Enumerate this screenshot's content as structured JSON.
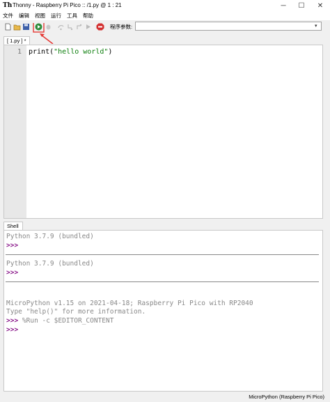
{
  "window": {
    "logo": "Th",
    "title": "Thonny  -  Raspberry Pi Pico :: /1.py  @  1 : 21",
    "minimize": "─",
    "maximize": "☐",
    "close": "✕"
  },
  "menu": [
    "文件",
    "编辑",
    "视图",
    "运行",
    "工具",
    "帮助"
  ],
  "toolbar": {
    "buttons": [
      "new-file-icon",
      "open-file-icon",
      "save-icon",
      "run-icon",
      "debug-icon",
      "step-over-icon",
      "step-into-icon",
      "step-out-icon",
      "resume-icon",
      "stop-icon"
    ],
    "args_label": "程序参数:",
    "args_value": "",
    "accent_run": "#2e8b3a",
    "accent_stop": "#d32f2f"
  },
  "editor": {
    "tab_label": "[ 1.py ] *",
    "tab_close": "×",
    "line_numbers": [
      "1"
    ],
    "code": {
      "func": "print(",
      "string": "\"hello world\"",
      "end": ")"
    }
  },
  "shell": {
    "tab_label": "Shell",
    "tab_close": "×",
    "lines": [
      "Python 3.7.9 (bundled)",
      ">>>",
      "Python 3.7.9 (bundled)",
      ">>>",
      "MicroPython v1.15 on 2021-04-18; Raspberry Pi Pico with RP2040",
      "Type \"help()\" for more information.",
      ">>> %Run -c $EDITOR_CONTENT",
      ">>>"
    ],
    "prompt": ">>>",
    "run_command": "%Run -c $EDITOR_CONTENT"
  },
  "status": {
    "interpreter": "MicroPython (Raspberry Pi Pico)"
  },
  "annotation_color": "#e53935"
}
